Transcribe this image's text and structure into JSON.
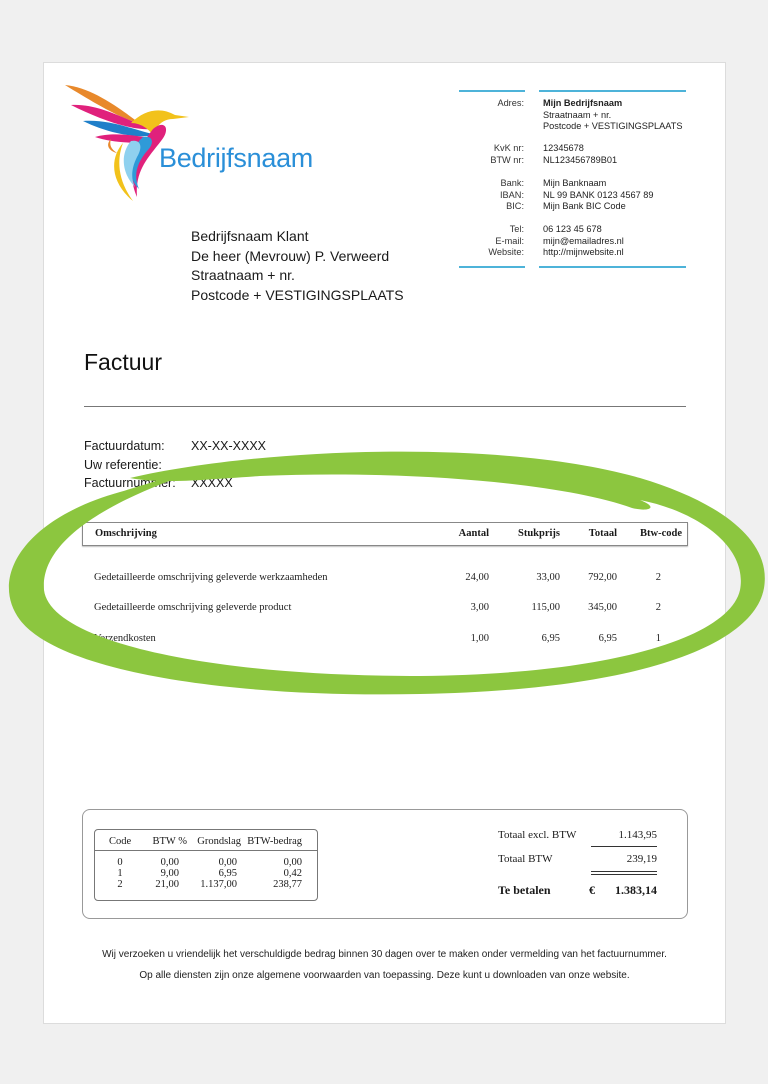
{
  "logo": {
    "company_name": "Bedrijfsnaam",
    "icon": "hummingbird-icon"
  },
  "sender": {
    "rows": [
      {
        "label": "Adres:",
        "value": "Mijn Bedrijfsnaam",
        "bold": true
      },
      {
        "label": "",
        "value": "Straatnaam + nr."
      },
      {
        "label": "",
        "value": "Postcode + VESTIGINGSPLAATS"
      },
      {
        "label": "KvK nr:",
        "value": "12345678"
      },
      {
        "label": "BTW nr:",
        "value": "NL123456789B01"
      },
      {
        "label": "Bank:",
        "value": "Mijn Banknaam"
      },
      {
        "label": "IBAN:",
        "value": "NL 99 BANK 0123 4567 89"
      },
      {
        "label": "BIC:",
        "value": "Mijn Bank BIC Code"
      },
      {
        "label": "Tel:",
        "value": "06 123 45 678"
      },
      {
        "label": "E-mail:",
        "value": "mijn@emailadres.nl"
      },
      {
        "label": "Website:",
        "value": "http://mijnwebsite.nl"
      }
    ]
  },
  "client": {
    "lines": [
      "Bedrijfsnaam Klant",
      "De heer (Mevrouw) P. Verweerd",
      "Straatnaam + nr.",
      "Postcode +  VESTIGINGSPLAATS"
    ]
  },
  "invoice": {
    "title": "Factuur",
    "meta": [
      {
        "label": "Factuurdatum:",
        "value": "XX-XX-XXXX"
      },
      {
        "label": "Uw referentie:",
        "value": ""
      },
      {
        "label": "Factuurnummer:",
        "value": "XXXXX"
      }
    ]
  },
  "lines_table": {
    "headers": {
      "description": "Omschrijving",
      "quantity": "Aantal",
      "unit_price": "Stukprijs",
      "total": "Totaal",
      "vat_code": "Btw-code"
    },
    "rows": [
      {
        "description": "Gedetailleerde omschrijving geleverde werkzaamheden",
        "quantity": "24,00",
        "unit_price": "33,00",
        "total": "792,00",
        "vat_code": "2"
      },
      {
        "description": "Gedetailleerde omschrijving geleverde product",
        "quantity": "3,00",
        "unit_price": "115,00",
        "total": "345,00",
        "vat_code": "2"
      },
      {
        "description": "Verzendkosten",
        "quantity": "1,00",
        "unit_price": "6,95",
        "total": "6,95",
        "vat_code": "1"
      }
    ]
  },
  "vat_summary": {
    "headers": {
      "code": "Code",
      "pct": "BTW %",
      "base": "Grondslag",
      "amount": "BTW-bedrag"
    },
    "rows": [
      {
        "code": "0",
        "pct": "0,00",
        "base": "0,00",
        "amount": "0,00"
      },
      {
        "code": "1",
        "pct": "9,00",
        "base": "6,95",
        "amount": "0,42"
      },
      {
        "code": "2",
        "pct": "21,00",
        "base": "1.137,00",
        "amount": "238,77"
      }
    ]
  },
  "totals": {
    "excl_label": "Totaal excl. BTW",
    "excl_value": "1.143,95",
    "vat_label": "Totaal BTW",
    "vat_value": "239,19",
    "due_label": "Te betalen",
    "currency": "€",
    "due_value": "1.383,14"
  },
  "footer": {
    "line1": "Wij verzoeken u vriendelijk het verschuldigde bedrag binnen 30 dagen over te maken onder vermelding van het factuurnummer.",
    "line2": "Op alle diensten zijn onze algemene voorwaarden van toepassing. Deze kunt u downloaden van onze website."
  },
  "colors": {
    "brand_blue": "#2a8fd8",
    "accent_rule": "#4db3d9",
    "highlight_green": "#8cc63f"
  }
}
